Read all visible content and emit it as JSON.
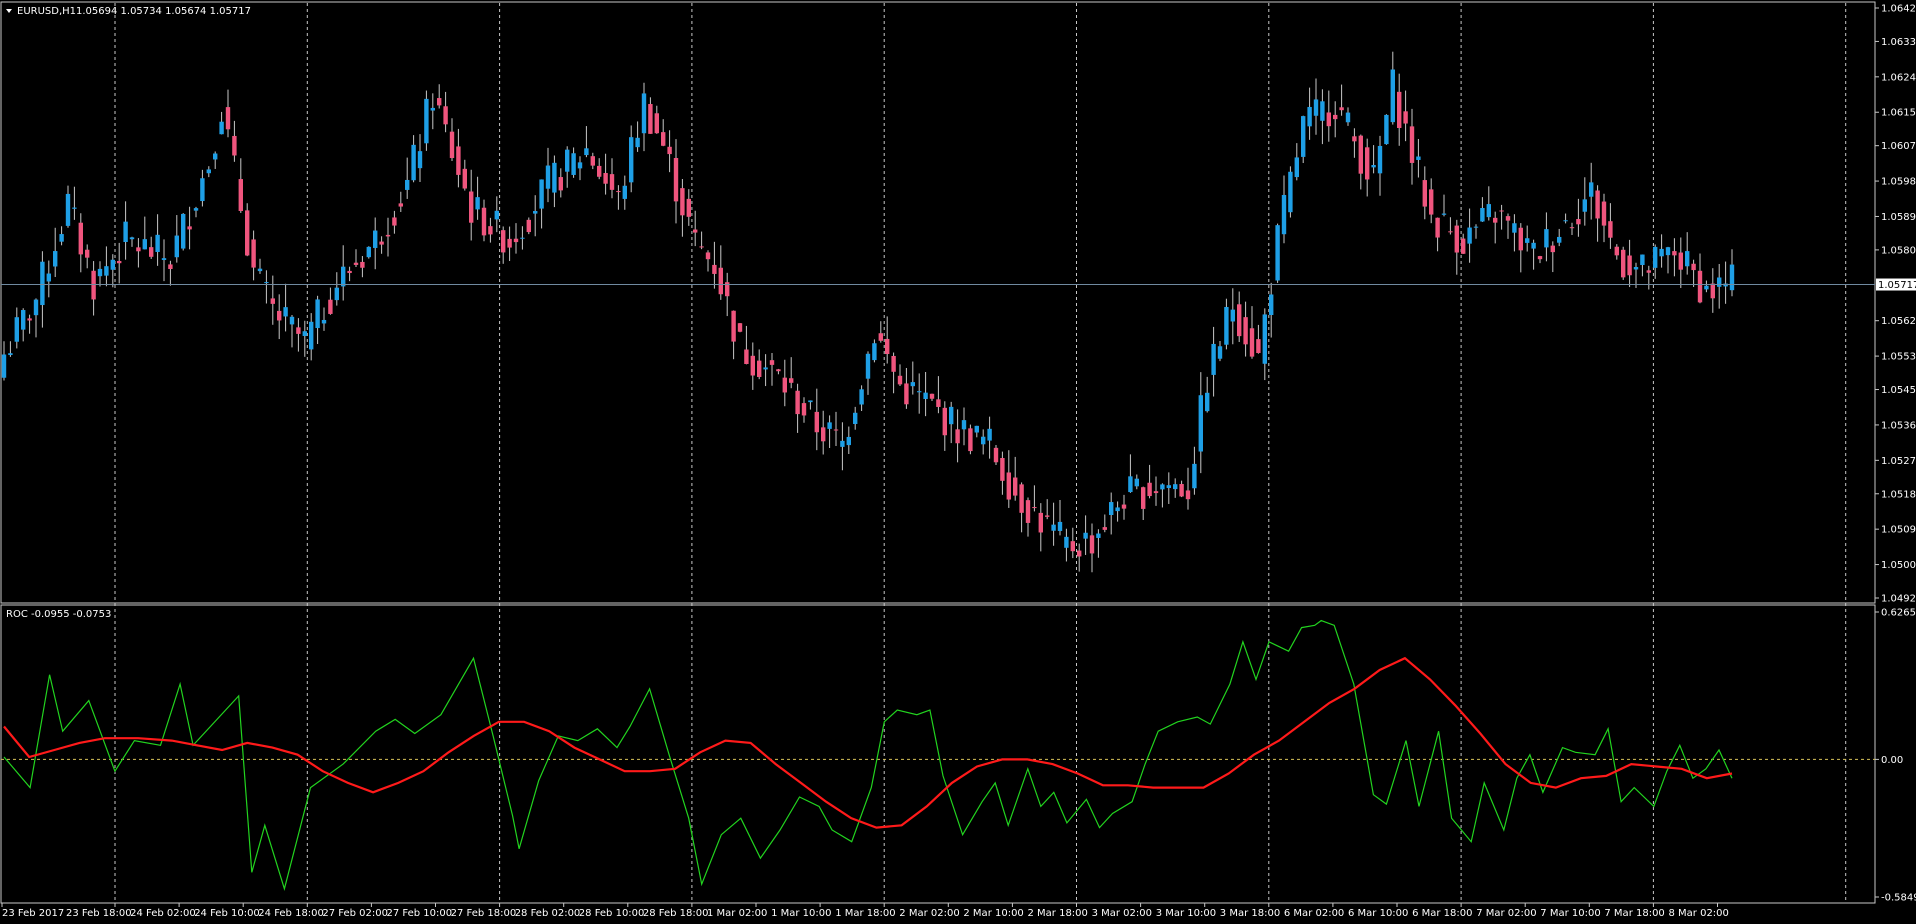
{
  "header": {
    "price_symbol": "EURUSD,H1",
    "price_ohlc": "1.05694 1.05734 1.05674 1.05717",
    "roc_label": "ROC -0.0955 -0.0753"
  },
  "colors": {
    "background": "#000000",
    "bull": "#1e9fe6",
    "bear": "#f0557e",
    "wick": "#c8c8c8",
    "grid": "#c8c8c8",
    "roc_line": "#22d31f",
    "roc_signal": "#ff1a1a",
    "bid_line": "#708aa0",
    "zero_line": "#d6c25a"
  },
  "chart_data": [
    {
      "type": "candlestick",
      "title": "EURUSD,H1",
      "ylim": [
        1.0492,
        1.0642
      ],
      "y_ticks": [
        "1.06420",
        "1.06335",
        "1.06245",
        "1.06155",
        "1.06070",
        "1.05980",
        "1.05890",
        "1.05805",
        "1.05625",
        "1.05535",
        "1.05450",
        "1.05360",
        "1.05270",
        "1.05185",
        "1.05095",
        "1.05005",
        "1.04920"
      ],
      "current_price": "1.05717",
      "x_labels": [
        "23 Feb 2017",
        "23 Feb 18:00",
        "24 Feb 02:00",
        "24 Feb 10:00",
        "24 Feb 18:00",
        "27 Feb 02:00",
        "27 Feb 10:00",
        "27 Feb 18:00",
        "28 Feb 02:00",
        "28 Feb 10:00",
        "28 Feb 18:00",
        "1 Mar 02:00",
        "1 Mar 10:00",
        "1 Mar 18:00",
        "2 Mar 02:00",
        "2 Mar 10:00",
        "2 Mar 18:00",
        "3 Mar 02:00",
        "3 Mar 10:00",
        "3 Mar 18:00",
        "6 Mar 02:00",
        "6 Mar 10:00",
        "6 Mar 18:00",
        "7 Mar 02:00",
        "7 Mar 10:00",
        "7 Mar 18:00",
        "8 Mar 02:00"
      ],
      "close_path": [
        [
          0,
          1.0554
        ],
        [
          5,
          1.0568
        ],
        [
          10,
          1.0592
        ],
        [
          14,
          1.0572
        ],
        [
          19,
          1.0583
        ],
        [
          26,
          1.0578
        ],
        [
          32,
          1.0603
        ],
        [
          34,
          1.0617
        ],
        [
          39,
          1.0575
        ],
        [
          42,
          1.0565
        ],
        [
          47,
          1.0557
        ],
        [
          52,
          1.0572
        ],
        [
          58,
          1.0583
        ],
        [
          63,
          1.0597
        ],
        [
          67,
          1.062
        ],
        [
          73,
          1.0591
        ],
        [
          79,
          1.0583
        ],
        [
          85,
          1.0597
        ],
        [
          91,
          1.0606
        ],
        [
          96,
          1.0593
        ],
        [
          100,
          1.0618
        ],
        [
          103,
          1.0607
        ],
        [
          108,
          1.0582
        ],
        [
          111,
          1.0577
        ],
        [
          115,
          1.0556
        ],
        [
          121,
          1.0548
        ],
        [
          127,
          1.0536
        ],
        [
          131,
          1.0531
        ],
        [
          136,
          1.056
        ],
        [
          140,
          1.0546
        ],
        [
          144,
          1.0542
        ],
        [
          149,
          1.0535
        ],
        [
          154,
          1.0531
        ],
        [
          158,
          1.0519
        ],
        [
          163,
          1.051
        ],
        [
          166,
          1.0505
        ],
        [
          170,
          1.0507
        ],
        [
          175,
          1.0518
        ],
        [
          181,
          1.0521
        ],
        [
          185,
          1.052
        ],
        [
          188,
          1.0548
        ],
        [
          192,
          1.0567
        ],
        [
          196,
          1.0553
        ],
        [
          199,
          1.0583
        ],
        [
          203,
          1.0612
        ],
        [
          208,
          1.0618
        ],
        [
          211,
          1.0608
        ],
        [
          214,
          1.0598
        ],
        [
          217,
          1.0622
        ],
        [
          220,
          1.0605
        ],
        [
          223,
          1.0589
        ],
        [
          228,
          1.0583
        ],
        [
          233,
          1.059
        ],
        [
          239,
          1.0579
        ],
        [
          243,
          1.0586
        ],
        [
          248,
          1.0595
        ],
        [
          252,
          1.0579
        ],
        [
          256,
          1.0575
        ],
        [
          261,
          1.058
        ],
        [
          266,
          1.057
        ],
        [
          270,
          1.0572
        ]
      ]
    },
    {
      "type": "line",
      "title": "ROC",
      "ylim": [
        -0.5849,
        0.6265
      ],
      "y_ticks": [
        "0.6265",
        "0.00",
        "-0.5849"
      ],
      "series": [
        {
          "name": "ROC",
          "points": [
            [
              0,
              0.01
            ],
            [
              4,
              -0.12
            ],
            [
              7,
              0.36
            ],
            [
              9,
              0.12
            ],
            [
              13,
              0.25
            ],
            [
              17,
              -0.05
            ],
            [
              20,
              0.08
            ],
            [
              24,
              0.06
            ],
            [
              27,
              0.32
            ],
            [
              29,
              0.06
            ],
            [
              33,
              0.18
            ],
            [
              36,
              0.27
            ],
            [
              38,
              -0.48
            ],
            [
              40,
              -0.28
            ],
            [
              43,
              -0.55
            ],
            [
              47,
              -0.12
            ],
            [
              52,
              -0.02
            ],
            [
              57,
              0.12
            ],
            [
              60,
              0.17
            ],
            [
              63,
              0.11
            ],
            [
              67,
              0.19
            ],
            [
              72,
              0.43
            ],
            [
              75,
              0.1
            ],
            [
              78,
              -0.24
            ],
            [
              79,
              -0.38
            ],
            [
              82,
              -0.09
            ],
            [
              85,
              0.1
            ],
            [
              88,
              0.08
            ],
            [
              91,
              0.13
            ],
            [
              94,
              0.05
            ],
            [
              96,
              0.14
            ],
            [
              99,
              0.3
            ],
            [
              102,
              0.02
            ],
            [
              105,
              -0.25
            ],
            [
              107,
              -0.53
            ],
            [
              110,
              -0.32
            ],
            [
              113,
              -0.25
            ],
            [
              116,
              -0.42
            ],
            [
              119,
              -0.3
            ],
            [
              122,
              -0.16
            ],
            [
              125,
              -0.2
            ],
            [
              127,
              -0.3
            ],
            [
              130,
              -0.35
            ],
            [
              133,
              -0.12
            ],
            [
              135,
              0.16
            ],
            [
              137,
              0.21
            ],
            [
              140,
              0.19
            ],
            [
              142,
              0.21
            ],
            [
              144,
              -0.07
            ],
            [
              147,
              -0.32
            ],
            [
              150,
              -0.18
            ],
            [
              152,
              -0.1
            ],
            [
              154,
              -0.28
            ],
            [
              157,
              -0.04
            ],
            [
              159,
              -0.2
            ],
            [
              161,
              -0.14
            ],
            [
              163,
              -0.27
            ],
            [
              166,
              -0.17
            ],
            [
              168,
              -0.29
            ],
            [
              170,
              -0.23
            ],
            [
              173,
              -0.18
            ],
            [
              175,
              -0.02
            ],
            [
              177,
              0.12
            ],
            [
              180,
              0.16
            ],
            [
              183,
              0.18
            ],
            [
              185,
              0.15
            ],
            [
              188,
              0.32
            ],
            [
              190,
              0.5
            ],
            [
              192,
              0.34
            ],
            [
              194,
              0.5
            ],
            [
              197,
              0.46
            ],
            [
              199,
              0.56
            ],
            [
              201,
              0.57
            ],
            [
              202,
              0.59
            ],
            [
              204,
              0.57
            ],
            [
              207,
              0.32
            ],
            [
              210,
              -0.15
            ],
            [
              212,
              -0.19
            ],
            [
              215,
              0.08
            ],
            [
              217,
              -0.2
            ],
            [
              220,
              0.12
            ],
            [
              222,
              -0.25
            ],
            [
              225,
              -0.35
            ],
            [
              227,
              -0.1
            ],
            [
              230,
              -0.3
            ],
            [
              232,
              -0.08
            ],
            [
              234,
              0.02
            ],
            [
              236,
              -0.14
            ],
            [
              239,
              0.05
            ],
            [
              241,
              0.03
            ],
            [
              244,
              0.02
            ],
            [
              246,
              0.13
            ],
            [
              248,
              -0.18
            ],
            [
              250,
              -0.12
            ],
            [
              253,
              -0.2
            ],
            [
              255,
              -0.05
            ],
            [
              257,
              0.06
            ],
            [
              259,
              -0.08
            ],
            [
              261,
              -0.04
            ],
            [
              263,
              0.04
            ],
            [
              265,
              -0.08
            ]
          ]
        },
        {
          "name": "Signal",
          "points": [
            [
              0,
              0.14
            ],
            [
              3,
              0.01
            ],
            [
              6,
              0.04
            ],
            [
              9,
              0.07
            ],
            [
              12,
              0.09
            ],
            [
              16,
              0.09
            ],
            [
              20,
              0.08
            ],
            [
              23,
              0.06
            ],
            [
              26,
              0.04
            ],
            [
              29,
              0.07
            ],
            [
              32,
              0.05
            ],
            [
              35,
              0.02
            ],
            [
              38,
              -0.05
            ],
            [
              41,
              -0.1
            ],
            [
              44,
              -0.14
            ],
            [
              47,
              -0.1
            ],
            [
              50,
              -0.05
            ],
            [
              53,
              0.03
            ],
            [
              56,
              0.1
            ],
            [
              59,
              0.16
            ],
            [
              62,
              0.16
            ],
            [
              65,
              0.12
            ],
            [
              68,
              0.05
            ],
            [
              71,
              0.0
            ],
            [
              74,
              -0.05
            ],
            [
              77,
              -0.05
            ],
            [
              80,
              -0.04
            ],
            [
              83,
              0.03
            ],
            [
              86,
              0.08
            ],
            [
              89,
              0.07
            ],
            [
              92,
              -0.02
            ],
            [
              95,
              -0.1
            ],
            [
              98,
              -0.18
            ],
            [
              101,
              -0.25
            ],
            [
              104,
              -0.29
            ],
            [
              107,
              -0.28
            ],
            [
              110,
              -0.2
            ],
            [
              113,
              -0.1
            ],
            [
              116,
              -0.03
            ],
            [
              119,
              0.0
            ],
            [
              122,
              0.0
            ],
            [
              125,
              -0.02
            ],
            [
              128,
              -0.06
            ],
            [
              131,
              -0.11
            ],
            [
              134,
              -0.11
            ],
            [
              137,
              -0.12
            ],
            [
              140,
              -0.12
            ],
            [
              143,
              -0.12
            ],
            [
              146,
              -0.06
            ],
            [
              149,
              0.02
            ],
            [
              152,
              0.08
            ],
            [
              155,
              0.16
            ],
            [
              158,
              0.24
            ],
            [
              161,
              0.3
            ],
            [
              164,
              0.38
            ],
            [
              167,
              0.43
            ],
            [
              170,
              0.34
            ],
            [
              173,
              0.23
            ],
            [
              176,
              0.11
            ],
            [
              179,
              -0.02
            ],
            [
              182,
              -0.1
            ],
            [
              185,
              -0.12
            ],
            [
              188,
              -0.08
            ],
            [
              191,
              -0.07
            ],
            [
              194,
              -0.02
            ],
            [
              197,
              -0.03
            ],
            [
              200,
              -0.04
            ],
            [
              203,
              -0.08
            ],
            [
              206,
              -0.06
            ]
          ]
        }
      ]
    }
  ]
}
